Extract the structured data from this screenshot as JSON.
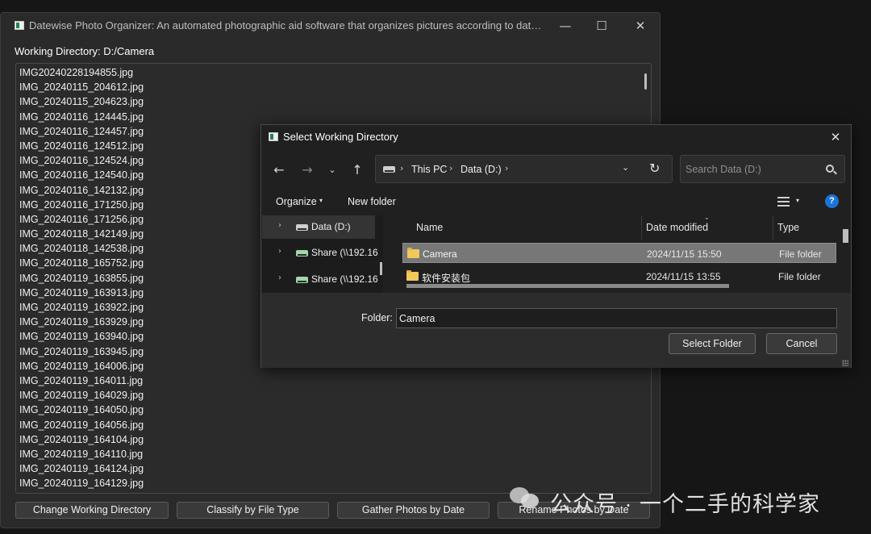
{
  "main_window": {
    "title": "Datewise Photo Organizer: An automated photographic aid software that organizes pictures according to date and ti...",
    "window_controls": {
      "minimize": "—",
      "maximize": "☐",
      "close": "✕"
    },
    "working_directory": "Working Directory: D:/Camera",
    "files": [
      "IMG20240228194855.jpg",
      "IMG_20240115_204612.jpg",
      "IMG_20240115_204623.jpg",
      "IMG_20240116_124445.jpg",
      "IMG_20240116_124457.jpg",
      "IMG_20240116_124512.jpg",
      "IMG_20240116_124524.jpg",
      "IMG_20240116_124540.jpg",
      "IMG_20240116_142132.jpg",
      "IMG_20240116_171250.jpg",
      "IMG_20240116_171256.jpg",
      "IMG_20240118_142149.jpg",
      "IMG_20240118_142538.jpg",
      "IMG_20240118_165752.jpg",
      "IMG_20240119_163855.jpg",
      "IMG_20240119_163913.jpg",
      "IMG_20240119_163922.jpg",
      "IMG_20240119_163929.jpg",
      "IMG_20240119_163940.jpg",
      "IMG_20240119_163945.jpg",
      "IMG_20240119_164006.jpg",
      "IMG_20240119_164011.jpg",
      "IMG_20240119_164029.jpg",
      "IMG_20240119_164050.jpg",
      "IMG_20240119_164056.jpg",
      "IMG_20240119_164104.jpg",
      "IMG_20240119_164110.jpg",
      "IMG_20240119_164124.jpg",
      "IMG_20240119_164129.jpg"
    ],
    "buttons": {
      "change_dir": "Change Working Directory",
      "classify": "Classify by File Type",
      "gather": "Gather Photos by Date",
      "rename": "Rename Photos by Date"
    }
  },
  "dialog": {
    "title": "Select Working Directory",
    "close": "✕",
    "nav": {
      "back": "←",
      "forward": "→",
      "history": "⌄",
      "up": "↑"
    },
    "breadcrumb": [
      "This PC",
      "Data (D:)"
    ],
    "breadcrumb_sep": "›",
    "address_dropdown": "⌄",
    "refresh": "↻",
    "search_placeholder": "Search Data (D:)",
    "toolbar": {
      "organize": "Organize",
      "caret": "▾",
      "new_folder": "New folder",
      "help": "?"
    },
    "nav_pane": [
      {
        "label": "Data (D:)",
        "chevron": "›",
        "icon": "drive-icon",
        "selected": true
      },
      {
        "label": "Share (\\\\192.16",
        "chevron": "›",
        "icon": "network-drive-icon",
        "selected": false
      },
      {
        "label": "Share (\\\\192.16",
        "chevron": "›",
        "icon": "network-drive-icon",
        "selected": false
      }
    ],
    "columns": {
      "name": "Name",
      "date": "Date modified",
      "type": "Type",
      "sort_caret": "⌄"
    },
    "rows": [
      {
        "name": "Camera",
        "date": "2024/11/15 15:50",
        "type": "File folder",
        "selected": true
      },
      {
        "name": "软件安装包",
        "date": "2024/11/15 13:55",
        "type": "File folder",
        "selected": false
      }
    ],
    "folder_label": "Folder:",
    "folder_value": "Camera",
    "select_button": "Select Folder",
    "cancel_button": "Cancel"
  },
  "watermark": {
    "text": "公众号 · 一个二手的科学家"
  },
  "colors": {
    "accent": "#1b73d8",
    "folder": "#f2c85b",
    "window_bg": "#2a2a2a",
    "dialog_bg": "#202020"
  }
}
